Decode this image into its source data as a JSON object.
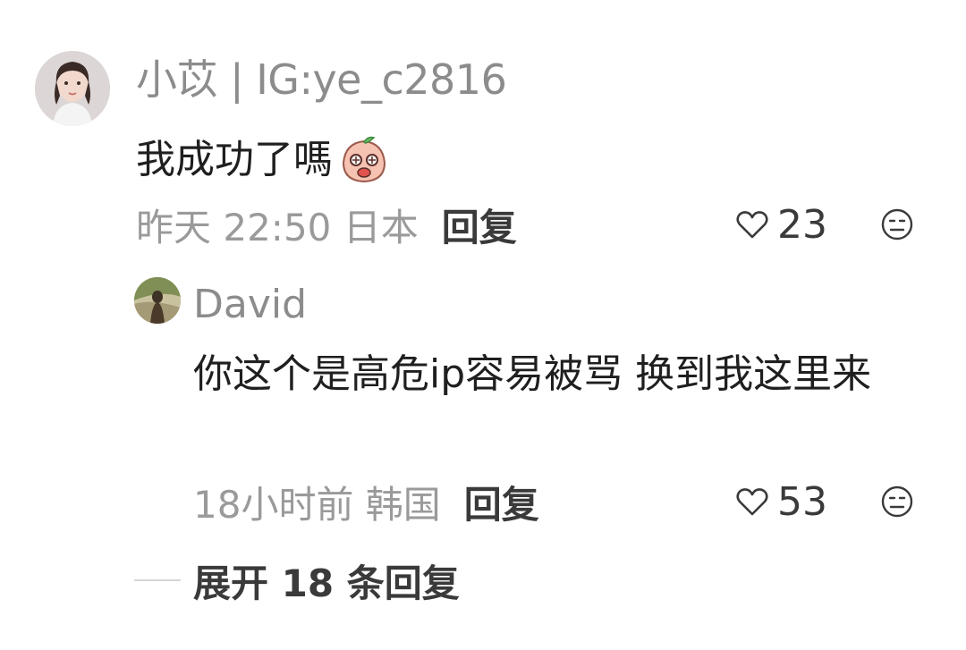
{
  "comment": {
    "username": "小苡 | IG:ye_c2816",
    "text": "我成功了嗎",
    "time_location": "昨天 22:50 日本",
    "reply_label": "回复",
    "like_count": "23",
    "emoji_icon": "shocked-peach-emoji-icon",
    "heart_icon": "heart-outline-icon",
    "dislike_icon": "meh-face-icon"
  },
  "reply": {
    "username": "David",
    "text": "你这个是高危ip容易被骂 换到我这里来",
    "time_location": "18小时前 韩国",
    "reply_label": "回复",
    "like_count": "53",
    "heart_icon": "heart-outline-icon",
    "dislike_icon": "meh-face-icon"
  },
  "expand": {
    "label": "展开 18 条回复"
  },
  "colors": {
    "username": "#8c8c8c",
    "text": "#1f1f1f",
    "meta": "#9a9a9a",
    "action": "#3a3a3a",
    "divider": "#d6d6d6"
  }
}
